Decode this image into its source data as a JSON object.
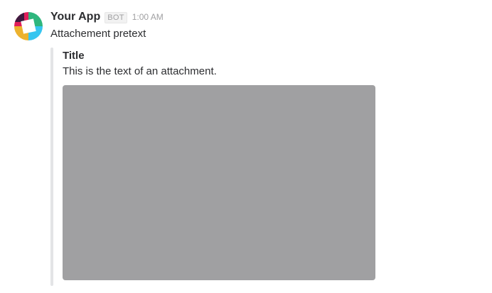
{
  "message": {
    "sender": "Your App",
    "badge": "BOT",
    "timestamp": "1:00 AM",
    "pretext": "Attachement pretext",
    "avatar_icon": "slack-logo-icon"
  },
  "attachment": {
    "title": "Title",
    "text": "This is the text of an attachment.",
    "image_placeholder_color": "#a0a0a2",
    "bar_color": "#e3e4e6"
  }
}
